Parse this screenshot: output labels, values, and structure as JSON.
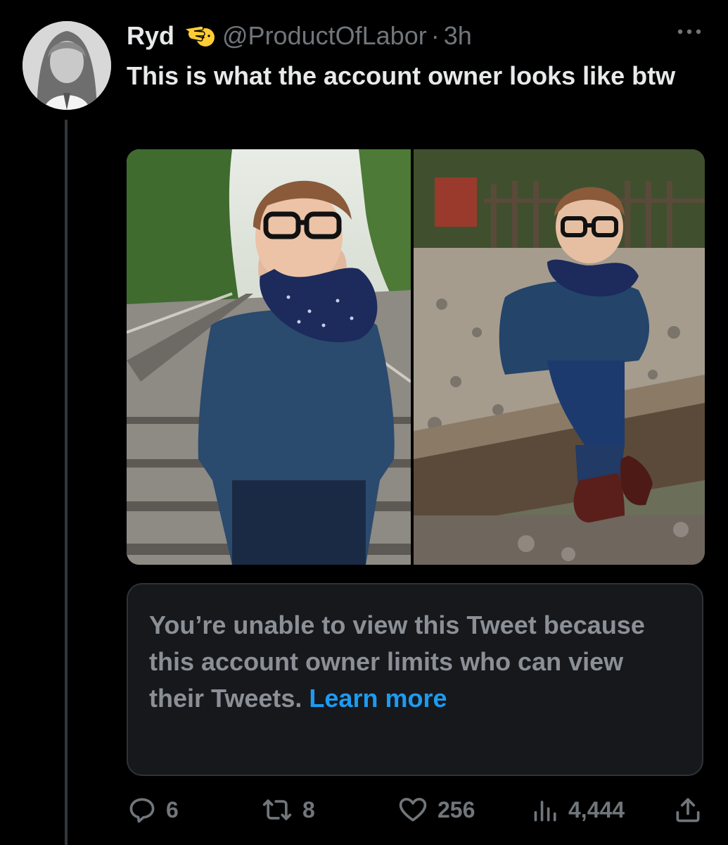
{
  "tweet": {
    "author_name": "Ryd",
    "author_badge_icon": "pointing-hand-emoji",
    "handle": "@ProductOfLabor",
    "separator": "·",
    "time": "3h",
    "more_icon": "more-horizontal-icon",
    "text": "This is what the account owner looks like btw"
  },
  "media": {
    "images": [
      "photo-boy-standing-on-railway-tracks",
      "photo-boy-sitting-on-rail"
    ]
  },
  "quoted_tweet": {
    "message": "You’re unable to view this Tweet because this account owner limits who can view their Tweets.",
    "link_text": "Learn more",
    "link_color": "#1d9bf0"
  },
  "actions": {
    "reply": {
      "icon": "reply-icon",
      "count": "6"
    },
    "retweet": {
      "icon": "retweet-icon",
      "count": "8"
    },
    "like": {
      "icon": "heart-icon",
      "count": "256"
    },
    "views": {
      "icon": "views-chart-icon",
      "count": "4,444"
    },
    "share": {
      "icon": "share-icon"
    }
  },
  "colors": {
    "background": "#000000",
    "text_primary": "#e7e9ea",
    "text_secondary": "#71767b",
    "card_background": "#16181c",
    "card_border": "#2f3336"
  }
}
